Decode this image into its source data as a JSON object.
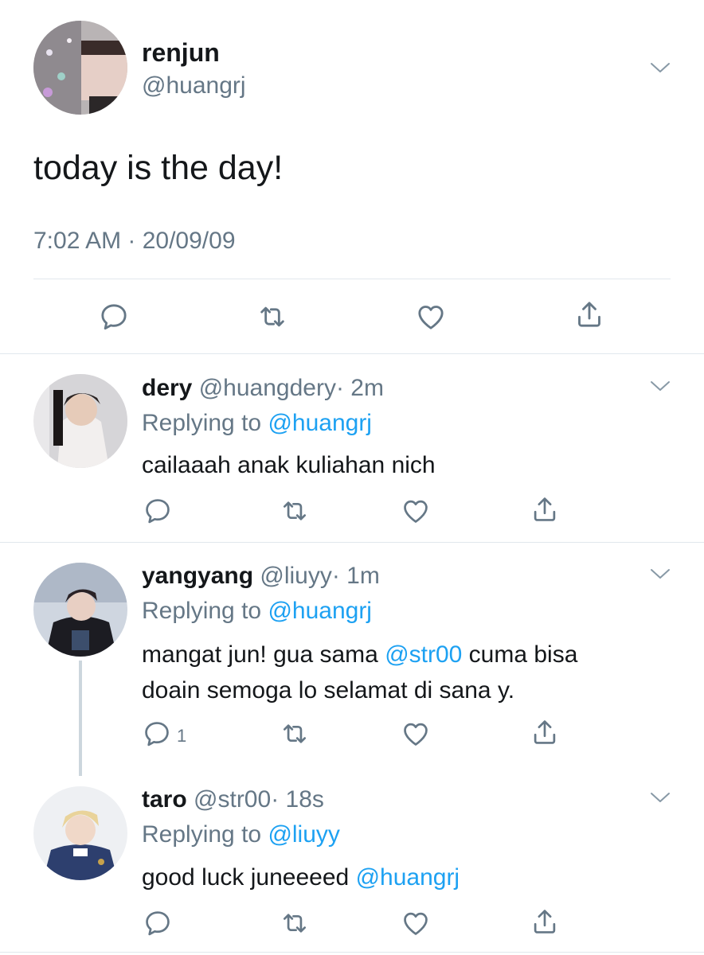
{
  "main_tweet": {
    "name": "renjun",
    "handle": "@huangrj",
    "text": "today is the day!",
    "timestamp": "7:02 AM · 20/09/09"
  },
  "replies": [
    {
      "name": "dery",
      "handle": "@huangdery",
      "time": "· 2m",
      "replying_label": "Replying to",
      "replying_to": "@huangrj",
      "text_parts": [
        "cailaaah anak kuliahan nich"
      ],
      "reply_count": ""
    },
    {
      "name": "yangyang",
      "handle": "@liuyy",
      "time": "· 1m",
      "replying_label": "Replying to",
      "replying_to": "@huangrj",
      "text_line1_a": "mangat jun! gua sama ",
      "text_line1_mention": "@str00",
      "text_line1_b": " cuma bisa",
      "text_line2": "doain semoga lo selamat di sana y.",
      "reply_count": "1"
    },
    {
      "name": "taro",
      "handle": "@str00",
      "time": "· 18s",
      "replying_label": "Replying to",
      "replying_to": "@liuyy",
      "text_a": "good luck juneeeed ",
      "text_mention": "@huangrj",
      "reply_count": ""
    }
  ],
  "colors": {
    "link": "#1da1f2",
    "secondary_text": "#657786",
    "divider": "#e1e8ed",
    "icon": "#657786"
  },
  "icons": [
    "reply-icon",
    "retweet-icon",
    "like-icon",
    "share-icon",
    "chevron-down-icon"
  ]
}
